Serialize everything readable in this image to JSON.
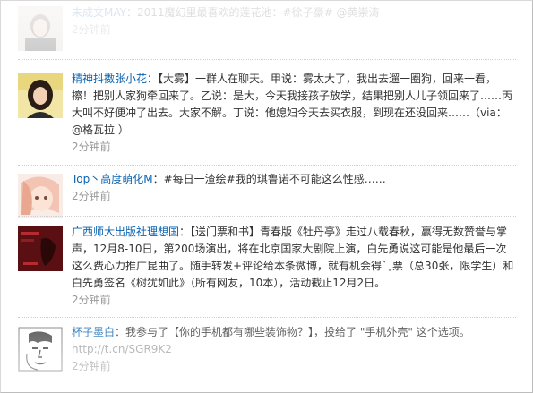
{
  "feed": {
    "items": [
      {
        "author": "未成文MAY",
        "separator": "：",
        "text": "2011魔幻里最喜欢的莲花池：#徐子豪# @黄崇涛",
        "time": "2分钟前",
        "avatar_icon": "portrait-avatar-icon"
      },
      {
        "author": "精神抖擞张小花",
        "separator": "：",
        "text": "【大雾】一群人在聊天。甲说：雾太大了，我出去遛一圈狗，回来一看，擦！把别人家狗牵回来了。乙说：是大，今天我接孩子放学，结果把别人儿子领回来了……丙大叫不好便冲了出去。大家不解。丁说：他媳妇今天去买衣服，到现在还没回来……（via：@格瓦拉 ）",
        "time": "2分钟前",
        "avatar_icon": "girl-photo-avatar-icon"
      },
      {
        "author": "Top丶高度萌化M",
        "separator": "：",
        "text": "#每日一渣绘#我的琪鲁诺不可能这么性感……",
        "time": "2分钟前",
        "avatar_icon": "anime-girl-avatar-icon"
      },
      {
        "author": "广西师大出版社理想国",
        "separator": "：",
        "text": "【送门票和书】青春版《牡丹亭》走过八载春秋，赢得无数赞誉与掌声，12月8-10日，第200场演出，将在北京国家大剧院上演，白先勇说这可能是他最后一次这么费心力推广昆曲了。随手转发+评论给本条微博，就有机会得门票（总30张，限学生）和白先勇签名《树犹如此》（所有网友，10本），活动截止12月2日。",
        "time": "2分钟前",
        "avatar_icon": "red-poster-avatar-icon"
      },
      {
        "author": "杯子墨白",
        "separator": "：",
        "text": "我参与了【你的手机都有哪些装饰物？】，投给了 \"手机外壳\" 这个选项。",
        "link": "http://t.cn/SGR9K2",
        "time": "2分钟前",
        "avatar_icon": "sketch-face-avatar-icon"
      }
    ]
  },
  "colors": {
    "name_link": "#0a63b0",
    "body_text": "#333333",
    "time_text": "#999999",
    "separator_line": "#cfcfcf"
  }
}
